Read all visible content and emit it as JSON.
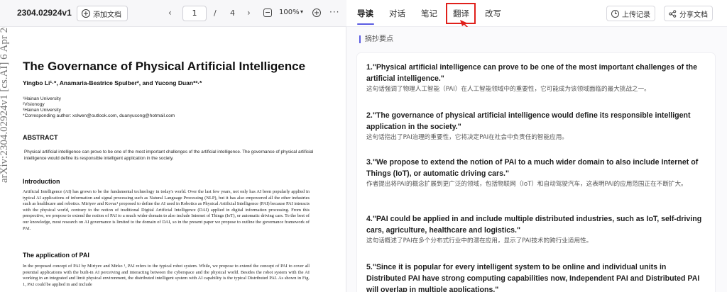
{
  "toolbar": {
    "doc_id": "2304.02924v1",
    "add_doc_label": "添加文档",
    "page_current": "1",
    "page_separator": "/",
    "page_total": "4",
    "zoom": "100%",
    "prev_glyph": "‹",
    "next_glyph": "›",
    "zoom_caret_glyph": "▾",
    "more_glyph": "···"
  },
  "tabs": [
    {
      "label": "导读",
      "active": true
    },
    {
      "label": "对话",
      "active": false
    },
    {
      "label": "笔记",
      "active": false
    },
    {
      "label": "翻译",
      "active": false
    },
    {
      "label": "改写",
      "active": false
    }
  ],
  "header_buttons": {
    "upload_record": "上传记录",
    "share_doc": "分享文档"
  },
  "colors": {
    "accent": "#5b5ce2",
    "highlight": "#e0201b"
  },
  "section_label": "摘抄要点",
  "summary_items": [
    {
      "en": "1.\"Physical artificial intelligence can prove to be one of the most important challenges of the artificial intelligence.\"",
      "zh": "这句话强调了物理人工智能（PAI）在人工智能领域中的重要性，它可能成为该领域面临的最大挑战之一。"
    },
    {
      "en": "2.\"The governance of physical artificial intelligence would define its responsible intelligent application in the society.\"",
      "zh": "这句话指出了PAI治理的重要性，它将决定PAI在社会中负责任的智能应用。"
    },
    {
      "en": "3.\"We propose to extend the notion of PAI to a much wider domain to also include Internet of Things (IoT), or automatic driving cars.\"",
      "zh": "作者提出将PAI的概念扩展到更广泛的领域，包括物联网（IoT）和自动驾驶汽车，这表明PAI的应用范围正在不断扩大。"
    },
    {
      "en": "4.\"PAI could be applied in and include multiple distributed industries, such as IoT, self-driving cars, agriculture, healthcare and logistics.\"",
      "zh": "这句话概述了PAI在多个分布式行业中的潜在应用，显示了PAI技术的跨行业适用性。"
    },
    {
      "en": "5.\"Since it is popular for every intelligent system to be online and individual units in Distributed PAI have strong computing capabilities now, Independent PAI and Distributed PAI will overlap in multiple applications.\"",
      "zh": ""
    }
  ],
  "paper": {
    "side_label": "arXiv:2304.02924v1  [cs.AI]  6 Apr 2023",
    "title": "The Governance of Physical Artificial Intelligence",
    "authors": "Yingbo Li¹·*, Anamaria-Beatrice Spulber², and Yucong Duan*³·*",
    "affiliations": [
      "¹Hainan University",
      "²Visionogy",
      "³Hainan University",
      "*Corresponding author: xslwen@outlook.com, duanyucong@hotmail.com"
    ],
    "abstract_heading": "ABSTRACT",
    "abstract_text": "Physical artificial intelligence can prove to be one of the most important challenges of the artificial intelligence. The governance of physical artificial intelligence would define its responsible intelligent application in the society.",
    "intro_heading": "Introduction",
    "intro_text": "Artificial Intelligence (AI) has grown to be the fundamental technology in today's world. Over the last few years, not only has AI been popularly applied in typical AI applications of information and signal processing such as Natural Language Processing (NLP), but it has also empowered all the other industries such as healthcare and robotics. Miriyev and Kovac¹ proposed to define the AI used in Robotics as Physical Artificial Intelligence (PAI) because PAI interacts with the physical world, contrary to the notion of traditional Digital Artificial Intelligence (DAI) applied in digital information processing. From this perspective, we propose to extend the notion of PAI to a much wider domain to also include Internet of Things (IoT), or automatic driving cars. To the best of our knowledge, most research on AI governance is limited to the domain of DAI, so in the present paper we propose to outline the governance framework of PAI.",
    "app_heading": "The application of PAI",
    "app_text": "In the proposed concept of PAI by Miriyev and Mirko ¹, PAI refers to the typical robot system. While, we propose to extend the concept of PAI to cover all potential applications with the built-in AI perceiving and interacting between the cyberspace and the physical world. Besides the robot system with the AI working in an integrated and limit physical environment, the distributed intelligent system with AI capability is the typical Distributed PAI. As shown in Fig. 1, PAI could be applied in and include"
  }
}
